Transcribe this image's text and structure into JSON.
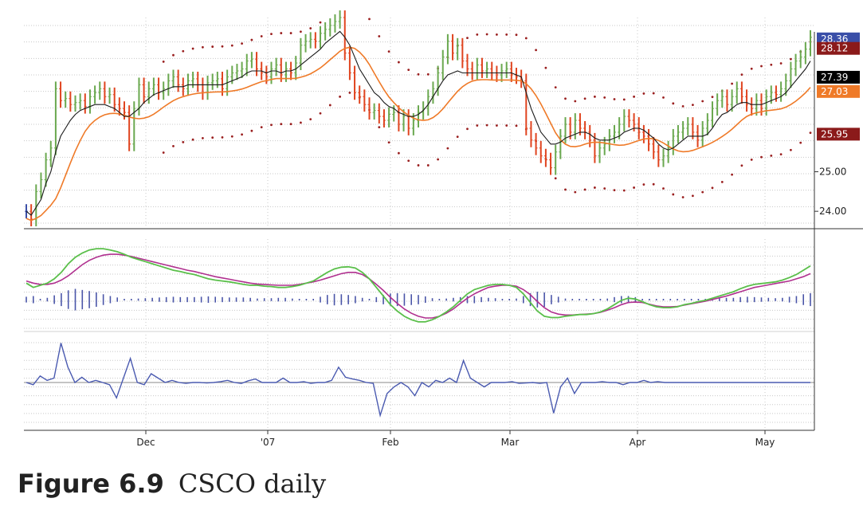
{
  "caption": {
    "number": "Figure 6.9",
    "text": "CSCO daily"
  },
  "colors": {
    "up": "#6aa84f",
    "down": "#e0441f",
    "neutral": "#3c4fa8",
    "fast_ma": "#1a1a1a",
    "slow_ma": "#ef7a28",
    "envelope": "#9a1f1f",
    "macd_line": "#5abf4a",
    "macd_signal": "#b0308f",
    "macd_hist": "#4a55a8",
    "osc": "#4a5ab0",
    "grid": "#c8c8c8"
  },
  "chart_data": [
    {
      "panel": "price",
      "type": "ohlc_bar",
      "x_range": [
        0,
        160
      ],
      "ylim": [
        23.6,
        28.9
      ],
      "ticks": [
        {
          "value": 24.0,
          "label": "24.00"
        },
        {
          "value": 25.0,
          "label": "25.00"
        }
      ],
      "value_tags": [
        {
          "value": 28.36,
          "label": "28.36",
          "color": "#3a4fa8"
        },
        {
          "value": 28.12,
          "label": "28.12",
          "color": "#8b1a1a"
        },
        {
          "value": 27.39,
          "label": "27.39",
          "color": "#000000"
        },
        {
          "value": 27.03,
          "label": "27.03",
          "color": "#ef7a28"
        },
        {
          "value": 25.95,
          "label": "25.95",
          "color": "#8b1a1a"
        }
      ],
      "bars": {
        "x_start": 0,
        "x_step": 1,
        "closes": [
          24,
          23.8,
          24.5,
          24.8,
          25.3,
          25.6,
          27.1,
          26.8,
          26.85,
          26.7,
          26.75,
          26.8,
          26.65,
          26.9,
          27.0,
          27.1,
          26.9,
          26.95,
          26.7,
          26.6,
          26.5,
          25.7,
          26.6,
          27.2,
          26.9,
          27.1,
          27.2,
          27.0,
          27.1,
          27.3,
          27.4,
          27.2,
          27.1,
          27.3,
          27.35,
          27.2,
          27.0,
          27.25,
          27.3,
          27.35,
          27.1,
          27.4,
          27.5,
          27.55,
          27.6,
          27.8,
          27.85,
          27.6,
          27.5,
          27.4,
          27.6,
          27.7,
          27.45,
          27.6,
          27.5,
          27.75,
          28.2,
          28.3,
          28.35,
          28.3,
          28.5,
          28.6,
          28.7,
          28.8,
          28.9,
          28.0,
          27.5,
          27.0,
          26.9,
          26.7,
          26.5,
          26.55,
          26.4,
          26.3,
          26.45,
          26.5,
          26.2,
          26.4,
          26.1,
          26.3,
          26.5,
          26.6,
          26.9,
          27.1,
          27.5,
          27.9,
          28.3,
          28.0,
          28.2,
          27.8,
          27.6,
          27.5,
          27.7,
          27.55,
          27.6,
          27.5,
          27.45,
          27.55,
          27.6,
          27.45,
          27.4,
          27.3,
          26.1,
          25.8,
          25.6,
          25.4,
          25.3,
          25.1,
          25.5,
          25.9,
          26.2,
          26.0,
          26.3,
          26.1,
          26.0,
          25.8,
          25.4,
          25.6,
          25.7,
          25.9,
          26.0,
          26.2,
          26.4,
          26.3,
          26.2,
          26.0,
          25.9,
          25.7,
          25.5,
          25.3,
          25.4,
          25.6,
          25.9,
          26.0,
          26.1,
          26.2,
          26.0,
          25.8,
          26.1,
          26.3,
          26.6,
          26.8,
          26.9,
          26.7,
          26.9,
          27.1,
          26.9,
          26.7,
          26.6,
          26.8,
          26.6,
          26.9,
          27.0,
          26.95,
          27.1,
          27.3,
          27.6,
          27.8,
          27.9,
          28.1,
          28.4
        ]
      },
      "fast_ma": [
        24,
        23.9,
        24.1,
        24.3,
        24.7,
        25.0,
        25.5,
        25.9,
        26.1,
        26.3,
        26.45,
        26.55,
        26.6,
        26.65,
        26.7,
        26.7,
        26.7,
        26.65,
        26.6,
        26.5,
        26.4,
        26.4,
        26.5,
        26.6,
        26.75,
        26.85,
        26.95,
        27.0,
        27.05,
        27.1,
        27.15,
        27.15,
        27.15,
        27.2,
        27.2,
        27.2,
        27.2,
        27.2,
        27.2,
        27.2,
        27.2,
        27.25,
        27.3,
        27.35,
        27.4,
        27.5,
        27.55,
        27.55,
        27.55,
        27.5,
        27.55,
        27.55,
        27.5,
        27.55,
        27.55,
        27.6,
        27.7,
        27.8,
        27.9,
        28.0,
        28.1,
        28.25,
        28.35,
        28.45,
        28.55,
        28.4,
        28.2,
        27.9,
        27.6,
        27.4,
        27.2,
        27.0,
        26.9,
        26.75,
        26.65,
        26.6,
        26.5,
        26.45,
        26.4,
        26.4,
        26.45,
        26.55,
        26.7,
        26.9,
        27.1,
        27.3,
        27.45,
        27.5,
        27.55,
        27.5,
        27.5,
        27.5,
        27.5,
        27.5,
        27.5,
        27.5,
        27.5,
        27.5,
        27.5,
        27.5,
        27.45,
        27.4,
        27.0,
        26.6,
        26.3,
        26.0,
        25.85,
        25.7,
        25.7,
        25.75,
        25.85,
        25.9,
        25.95,
        26.0,
        26.0,
        25.95,
        25.85,
        25.8,
        25.8,
        25.8,
        25.85,
        25.9,
        26.0,
        26.05,
        26.1,
        26.1,
        26.05,
        25.95,
        25.85,
        25.7,
        25.6,
        25.55,
        25.6,
        25.7,
        25.8,
        25.9,
        25.9,
        25.9,
        25.9,
        25.95,
        26.1,
        26.3,
        26.45,
        26.5,
        26.6,
        26.7,
        26.75,
        26.75,
        26.7,
        26.7,
        26.7,
        26.75,
        26.8,
        26.85,
        26.9,
        27.0,
        27.15,
        27.3,
        27.45,
        27.6,
        27.8
      ]
    },
    {
      "panel": "macd",
      "type": "line",
      "ylim": [
        -1.0,
        1.0
      ],
      "series": [
        {
          "values": [
            0.05,
            -0.05,
            0.0,
            0.05,
            0.15,
            0.3,
            0.5,
            0.65,
            0.75,
            0.82,
            0.85,
            0.85,
            0.82,
            0.78,
            0.72,
            0.65,
            0.6,
            0.55,
            0.5,
            0.45,
            0.4,
            0.35,
            0.32,
            0.28,
            0.25,
            0.2,
            0.15,
            0.12,
            0.1,
            0.08,
            0.05,
            0.02,
            0.0,
            0.0,
            -0.02,
            -0.03,
            -0.05,
            -0.05,
            -0.03,
            0.0,
            0.05,
            0.1,
            0.2,
            0.3,
            0.38,
            0.42,
            0.43,
            0.4,
            0.3,
            0.15,
            -0.05,
            -0.25,
            -0.45,
            -0.6,
            -0.72,
            -0.8,
            -0.85,
            -0.85,
            -0.8,
            -0.72,
            -0.62,
            -0.5,
            -0.35,
            -0.2,
            -0.1,
            -0.05,
            0.0,
            0.02,
            0.02,
            0.0,
            -0.05,
            -0.2,
            -0.4,
            -0.6,
            -0.72,
            -0.75,
            -0.75,
            -0.72,
            -0.7,
            -0.68,
            -0.68,
            -0.66,
            -0.62,
            -0.55,
            -0.45,
            -0.35,
            -0.3,
            -0.32,
            -0.38,
            -0.45,
            -0.5,
            -0.52,
            -0.52,
            -0.5,
            -0.45,
            -0.42,
            -0.38,
            -0.35,
            -0.3,
            -0.25,
            -0.2,
            -0.15,
            -0.08,
            -0.02,
            0.02,
            0.04,
            0.06,
            0.08,
            0.12,
            0.18,
            0.25,
            0.35,
            0.45
          ]
        },
        {
          "values": [
            0.1,
            0.05,
            0.02,
            0.02,
            0.05,
            0.12,
            0.22,
            0.35,
            0.48,
            0.58,
            0.65,
            0.7,
            0.72,
            0.72,
            0.7,
            0.67,
            0.63,
            0.59,
            0.55,
            0.51,
            0.47,
            0.43,
            0.39,
            0.35,
            0.32,
            0.28,
            0.24,
            0.2,
            0.17,
            0.14,
            0.11,
            0.08,
            0.05,
            0.03,
            0.02,
            0.01,
            0.0,
            0.0,
            0.0,
            0.02,
            0.05,
            0.08,
            0.12,
            0.17,
            0.22,
            0.27,
            0.3,
            0.3,
            0.25,
            0.15,
            0.02,
            -0.12,
            -0.28,
            -0.42,
            -0.55,
            -0.65,
            -0.72,
            -0.76,
            -0.76,
            -0.72,
            -0.65,
            -0.55,
            -0.42,
            -0.3,
            -0.2,
            -0.12,
            -0.05,
            -0.02,
            0.0,
            0.0,
            -0.02,
            -0.1,
            -0.22,
            -0.38,
            -0.52,
            -0.62,
            -0.67,
            -0.69,
            -0.69,
            -0.68,
            -0.67,
            -0.66,
            -0.63,
            -0.58,
            -0.52,
            -0.45,
            -0.4,
            -0.39,
            -0.4,
            -0.44,
            -0.48,
            -0.5,
            -0.5,
            -0.49,
            -0.46,
            -0.43,
            -0.4,
            -0.37,
            -0.33,
            -0.29,
            -0.25,
            -0.2,
            -0.15,
            -0.1,
            -0.05,
            -0.02,
            0.01,
            0.04,
            0.07,
            0.1,
            0.15,
            0.2,
            0.27
          ]
        }
      ],
      "histogram": [
        -0.08,
        -0.1,
        -0.02,
        0.05,
        0.12,
        0.18,
        0.26,
        0.3,
        0.27,
        0.24,
        0.2,
        0.15,
        0.1,
        0.06,
        0.02,
        -0.02,
        -0.03,
        -0.04,
        -0.05,
        -0.06,
        -0.07,
        -0.08,
        -0.07,
        -0.07,
        -0.07,
        -0.08,
        -0.09,
        -0.08,
        -0.07,
        -0.06,
        -0.06,
        -0.06,
        -0.05,
        -0.03,
        -0.04,
        -0.04,
        -0.05,
        -0.05,
        -0.03,
        -0.02,
        0.0,
        0.02,
        0.08,
        0.13,
        0.16,
        0.15,
        0.13,
        0.1,
        0.05,
        0.0,
        -0.07,
        -0.13,
        -0.17,
        -0.18,
        -0.17,
        -0.15,
        -0.13,
        -0.09,
        -0.04,
        0.0,
        0.03,
        0.05,
        0.07,
        0.1,
        0.1,
        0.07,
        0.05,
        0.04,
        0.02,
        0.0,
        -0.03,
        -0.1,
        -0.18,
        -0.22,
        -0.2,
        -0.13,
        -0.08,
        -0.03,
        -0.01,
        0.0,
        0.01,
        0.0,
        0.01,
        0.03,
        0.07,
        0.1,
        0.1,
        0.07,
        0.02,
        -0.01,
        -0.02,
        -0.02,
        -0.02,
        -0.01,
        0.01,
        0.01,
        0.02,
        0.02,
        0.03,
        0.04,
        0.05,
        0.05,
        0.07,
        0.08,
        0.07,
        0.06,
        0.05,
        0.04,
        0.05,
        0.08,
        0.1,
        0.15,
        0.18
      ]
    },
    {
      "panel": "oscillator",
      "type": "line",
      "ylim": [
        -1.0,
        1.0
      ],
      "series": [
        {
          "values": [
            0.0,
            -0.05,
            0.15,
            0.05,
            0.1,
            0.9,
            0.35,
            0.0,
            0.12,
            0.0,
            0.05,
            0.0,
            -0.05,
            -0.35,
            0.1,
            0.55,
            0.0,
            -0.05,
            0.2,
            0.1,
            0.0,
            0.05,
            0.0,
            -0.02,
            0.0,
            0.0,
            -0.01,
            0.0,
            0.02,
            0.05,
            0.0,
            -0.02,
            0.04,
            0.08,
            0.0,
            0.0,
            0.0,
            0.1,
            0.0,
            0.0,
            0.02,
            -0.02,
            0.0,
            0.0,
            0.05,
            0.35,
            0.12,
            0.08,
            0.05,
            0.0,
            -0.02,
            -0.75,
            -0.25,
            -0.1,
            0.0,
            -0.1,
            -0.3,
            0.0,
            -0.1,
            0.05,
            0.0,
            0.1,
            0.0,
            0.5,
            0.1,
            0.0,
            -0.1,
            0.0,
            0.0,
            0.0,
            0.02,
            -0.02,
            -0.01,
            0.0,
            -0.02,
            0.0,
            -0.7,
            -0.1,
            0.1,
            -0.25,
            0.0,
            0.0,
            0.0,
            0.02,
            0.0,
            0.0,
            -0.05,
            0.0,
            0.0,
            0.05,
            0.0,
            0.02,
            0.0,
            0.0,
            0.0,
            0.0,
            0.0,
            0.0,
            0.0,
            0.0,
            0.0,
            0.0,
            0.0,
            0.0,
            0.0,
            0.0,
            0.0,
            0.0,
            0.0,
            0.0,
            0.0,
            0.0,
            0.0,
            0.0
          ]
        }
      ]
    },
    {
      "panel": "x-axis",
      "type": "date_labels",
      "labels": [
        "Dec",
        "'07",
        "Feb",
        "Mar",
        "Apr",
        "May"
      ]
    }
  ]
}
